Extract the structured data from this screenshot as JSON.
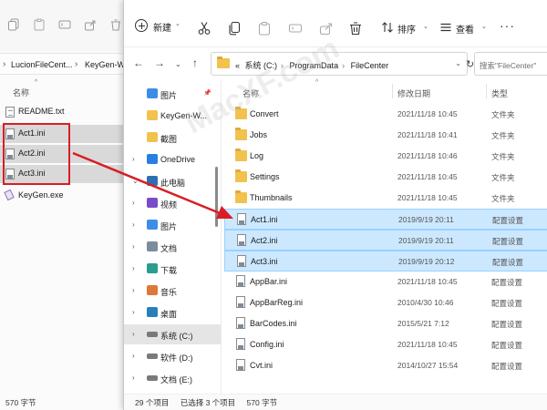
{
  "back_window": {
    "breadcrumb": [
      "LucionFileCent...",
      "KeyGen-W"
    ],
    "column_name": "名称",
    "files": [
      {
        "name": "README.txt",
        "kind": "txt",
        "selected": false
      },
      {
        "name": "Act1.ini",
        "kind": "ini",
        "selected": true
      },
      {
        "name": "Act2.ini",
        "kind": "ini",
        "selected": true
      },
      {
        "name": "Act3.ini",
        "kind": "ini",
        "selected": true
      },
      {
        "name": "KeyGen.exe",
        "kind": "exe",
        "selected": false
      }
    ],
    "status": "570 字节"
  },
  "toolbar": {
    "new_label": "新建",
    "sort_label": "排序",
    "view_label": "查看",
    "more_label": "···"
  },
  "address": {
    "prefix": "«",
    "crumbs": [
      "系统 (C:)",
      "ProgramData",
      "FileCenter"
    ],
    "search_placeholder": "搜索\"FileCenter\""
  },
  "nav_pane": {
    "items": [
      {
        "label": "图片",
        "icon": "pictures-icon",
        "pinned": true,
        "chevron": ""
      },
      {
        "label": "KeyGen-W...",
        "icon": "folder-icon",
        "pinned": false,
        "chevron": ""
      },
      {
        "label": "截图",
        "icon": "folder-icon",
        "pinned": false,
        "chevron": ""
      },
      {
        "label": "OneDrive",
        "icon": "cloud-icon",
        "pinned": false,
        "chevron": "›"
      },
      {
        "label": "此电脑",
        "icon": "computer-icon",
        "pinned": false,
        "chevron": "⌄"
      },
      {
        "label": "视频",
        "icon": "video-icon",
        "pinned": false,
        "chevron": "›"
      },
      {
        "label": "图片",
        "icon": "pictures-icon",
        "pinned": false,
        "chevron": "›"
      },
      {
        "label": "文档",
        "icon": "documents-icon",
        "pinned": false,
        "chevron": "›"
      },
      {
        "label": "下载",
        "icon": "download-icon",
        "pinned": false,
        "chevron": "›"
      },
      {
        "label": "音乐",
        "icon": "music-icon",
        "pinned": false,
        "chevron": "›"
      },
      {
        "label": "桌面",
        "icon": "desktop-icon",
        "pinned": false,
        "chevron": "›"
      },
      {
        "label": "系统 (C:)",
        "icon": "drive-icon",
        "pinned": false,
        "chevron": "›",
        "selected": true
      },
      {
        "label": "软件 (D:)",
        "icon": "drive-icon",
        "pinned": false,
        "chevron": "›"
      },
      {
        "label": "文档 (E:)",
        "icon": "drive-icon",
        "pinned": false,
        "chevron": "›"
      }
    ]
  },
  "file_list": {
    "columns": {
      "name": "名称",
      "modified": "修改日期",
      "type": "类型"
    },
    "rows": [
      {
        "name": "Convert",
        "modified": "2021/11/18 10:45",
        "type": "文件夹",
        "kind": "folder",
        "selected": false
      },
      {
        "name": "Jobs",
        "modified": "2021/11/18 10:41",
        "type": "文件夹",
        "kind": "folder",
        "selected": false
      },
      {
        "name": "Log",
        "modified": "2021/11/18 10:46",
        "type": "文件夹",
        "kind": "folder",
        "selected": false
      },
      {
        "name": "Settings",
        "modified": "2021/11/18 10:45",
        "type": "文件夹",
        "kind": "folder",
        "selected": false
      },
      {
        "name": "Thumbnails",
        "modified": "2021/11/18 10:45",
        "type": "文件夹",
        "kind": "folder",
        "selected": false
      },
      {
        "name": "Act1.ini",
        "modified": "2019/9/19 20:11",
        "type": "配置设置",
        "kind": "ini",
        "selected": true
      },
      {
        "name": "Act2.ini",
        "modified": "2019/9/19 20:11",
        "type": "配置设置",
        "kind": "ini",
        "selected": true
      },
      {
        "name": "Act3.ini",
        "modified": "2019/9/19 20:12",
        "type": "配置设置",
        "kind": "ini",
        "selected": true
      },
      {
        "name": "AppBar.ini",
        "modified": "2021/11/18 10:45",
        "type": "配置设置",
        "kind": "ini",
        "selected": false
      },
      {
        "name": "AppBarReg.ini",
        "modified": "2010/4/30 10:46",
        "type": "配置设置",
        "kind": "ini",
        "selected": false
      },
      {
        "name": "BarCodes.ini",
        "modified": "2015/5/21 7:12",
        "type": "配置设置",
        "kind": "ini",
        "selected": false
      },
      {
        "name": "Config.ini",
        "modified": "2021/11/18 10:45",
        "type": "配置设置",
        "kind": "ini",
        "selected": false
      },
      {
        "name": "Cvt.ini",
        "modified": "2014/10/27 15:54",
        "type": "配置设置",
        "kind": "ini",
        "selected": false
      }
    ]
  },
  "status_bar": {
    "item_count": "29 个项目",
    "selected": "已选择 3 个项目",
    "size": "570 字节"
  },
  "colors": {
    "selection_fill": "#cce8ff",
    "selection_border": "#99d1ff",
    "annotation_red": "#d81e24",
    "folder_yellow": "#f2c24f"
  },
  "watermark": "MacXF.com"
}
